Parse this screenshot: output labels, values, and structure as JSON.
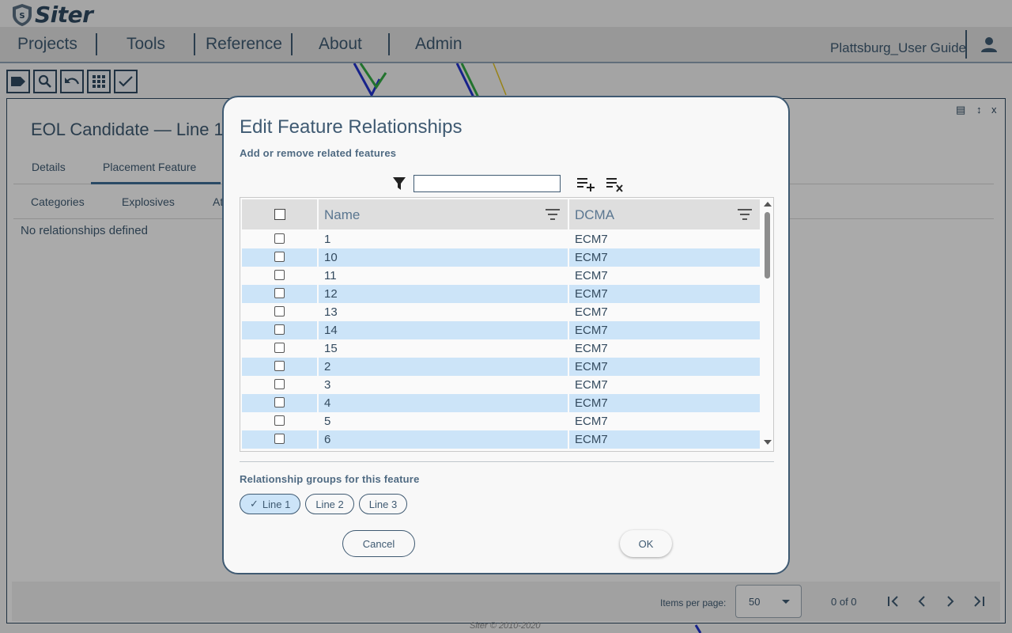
{
  "app": {
    "brand": "Siter",
    "nav": [
      "Projects",
      "Tools",
      "Reference",
      "About",
      "Admin"
    ],
    "user_label": "Plattsburg_User Guide",
    "footer": "Siter © 2010-2020"
  },
  "toolbar": {
    "icons": [
      "label-icon",
      "search-icon",
      "undo-icon",
      "grid-icon",
      "check-icon"
    ]
  },
  "panel": {
    "title": "EOL Candidate — Line 1",
    "controls": [
      "▤",
      "↕",
      "x"
    ],
    "tabs": [
      "Details",
      "Placement Feature"
    ],
    "subtabs": [
      "Categories",
      "Explosives",
      "At"
    ],
    "empty_text": "No relationships defined",
    "paginator": {
      "items_per_page_label": "Items per page:",
      "items_per_page_value": "50",
      "range_label": "0 of 0"
    }
  },
  "dialog": {
    "title": "Edit Feature Relationships",
    "subtitle": "Add or remove related features",
    "filter_value": "",
    "columns": [
      "Name",
      "DCMA"
    ],
    "rows": [
      {
        "name": "1",
        "dcma": "ECM7"
      },
      {
        "name": "10",
        "dcma": "ECM7"
      },
      {
        "name": "11",
        "dcma": "ECM7"
      },
      {
        "name": "12",
        "dcma": "ECM7"
      },
      {
        "name": "13",
        "dcma": "ECM7"
      },
      {
        "name": "14",
        "dcma": "ECM7"
      },
      {
        "name": "15",
        "dcma": "ECM7"
      },
      {
        "name": "2",
        "dcma": "ECM7"
      },
      {
        "name": "3",
        "dcma": "ECM7"
      },
      {
        "name": "4",
        "dcma": "ECM7"
      },
      {
        "name": "5",
        "dcma": "ECM7"
      },
      {
        "name": "6",
        "dcma": "ECM7"
      }
    ],
    "groups_label": "Relationship groups for this feature",
    "groups": [
      {
        "label": "Line 1",
        "selected": true
      },
      {
        "label": "Line 2",
        "selected": false
      },
      {
        "label": "Line 3",
        "selected": false
      }
    ],
    "cancel_label": "Cancel",
    "ok_label": "OK"
  },
  "colors": {
    "primary": "#3f5a72",
    "row_highlight": "#cce4f8",
    "header_bg": "#dedede"
  }
}
